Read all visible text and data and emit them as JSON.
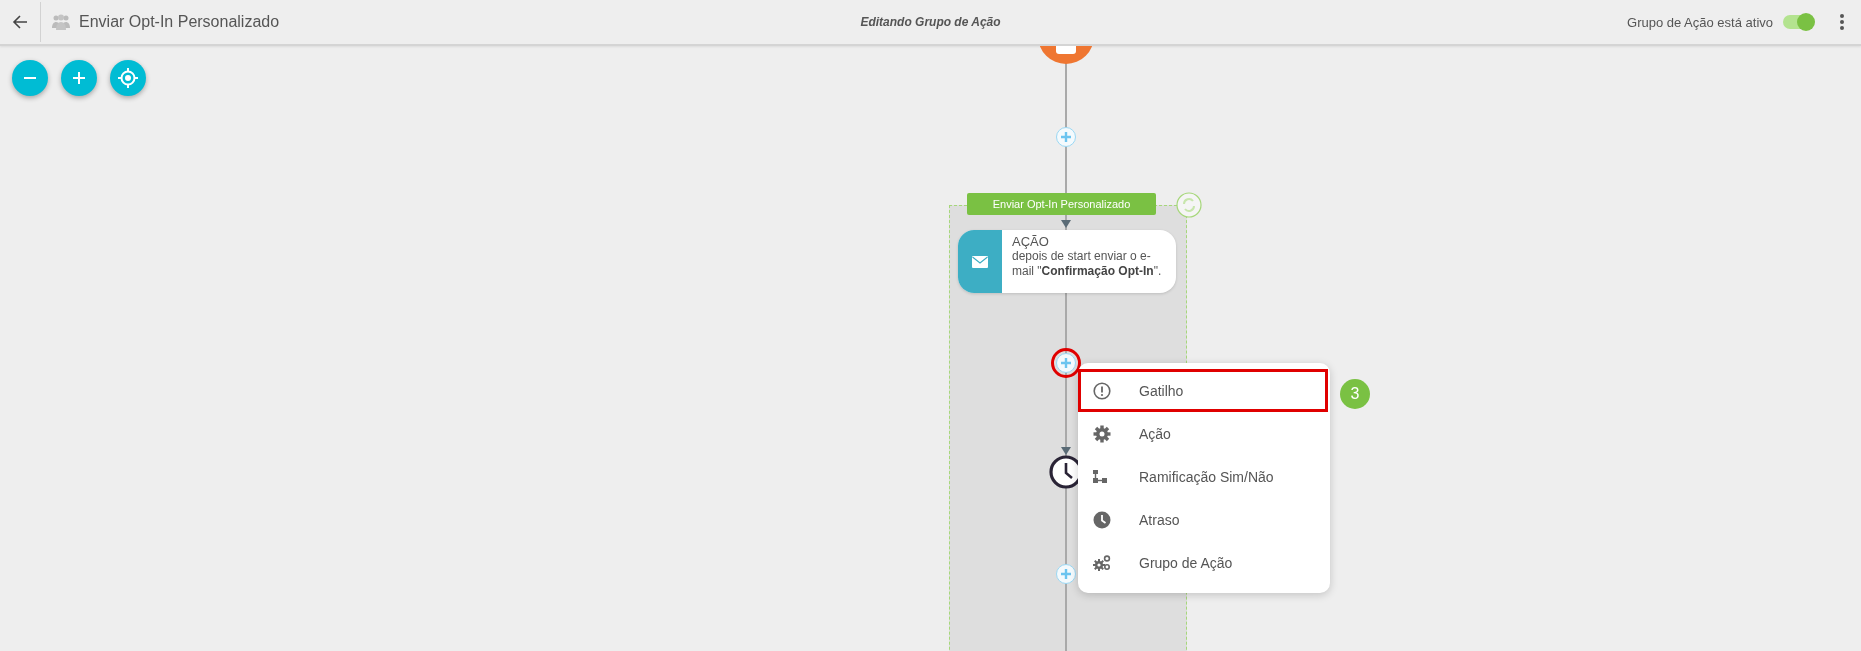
{
  "header": {
    "title": "Enviar Opt-In Personalizado",
    "subtitle": "Editando Grupo de Ação",
    "status_label": "Grupo de Ação está ativo",
    "active": true
  },
  "group": {
    "label": "Enviar Opt-In Personalizado"
  },
  "action_card": {
    "type": "AÇÃO",
    "description": "depois de start enviar o e-mail \"**Confirmação Opt-In**\"."
  },
  "menu": {
    "items": [
      {
        "kind": "trigger",
        "label": "Gatilho",
        "highlighted": true
      },
      {
        "kind": "action",
        "label": "Ação",
        "highlighted": false
      },
      {
        "kind": "branch",
        "label": "Ramificação Sim/Não",
        "highlighted": false
      },
      {
        "kind": "delay",
        "label": "Atraso",
        "highlighted": false
      },
      {
        "kind": "group",
        "label": "Grupo de Ação",
        "highlighted": false
      }
    ]
  },
  "step_badge": "3"
}
